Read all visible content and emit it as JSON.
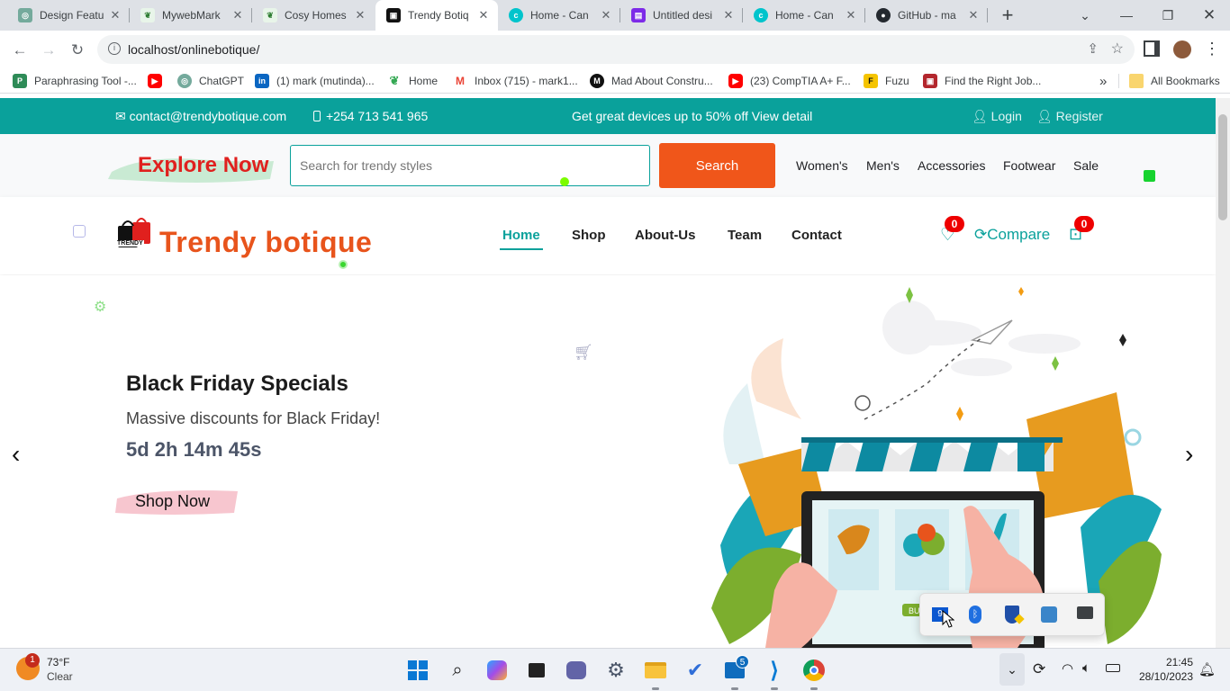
{
  "browser": {
    "tabs": [
      {
        "title": "Design Featu",
        "active": false
      },
      {
        "title": "MywebMark",
        "active": false
      },
      {
        "title": "Cosy Homes",
        "active": false
      },
      {
        "title": "Trendy Botiq",
        "active": true
      },
      {
        "title": "Home - Can",
        "active": false
      },
      {
        "title": "Untitled desi",
        "active": false
      },
      {
        "title": "Home - Can",
        "active": false
      },
      {
        "title": "GitHub - ma",
        "active": false
      }
    ],
    "new_tab_label": "+",
    "url": "localhost/onlinebotique/",
    "bookmarks": [
      {
        "label": "Paraphrasing Tool -...",
        "icon": "paraphrase-icon",
        "color": "#2e8b57"
      },
      {
        "label": "",
        "icon": "youtube-icon",
        "color": "#ff0000"
      },
      {
        "label": "ChatGPT",
        "icon": "chatgpt-icon",
        "color": "#74aa9c"
      },
      {
        "label": "(1) mark (mutinda)...",
        "icon": "linkedin-icon",
        "color": "#0a66c2"
      },
      {
        "label": "Home",
        "icon": "leaf-icon",
        "color": "#34a853"
      },
      {
        "label": "Inbox (715) - mark1...",
        "icon": "gmail-icon",
        "color": "#ea4335"
      },
      {
        "label": "Mad About Constru...",
        "icon": "mad-icon",
        "color": "#111111"
      },
      {
        "label": "(23) CompTIA A+ F...",
        "icon": "youtube-icon",
        "color": "#ff0000"
      },
      {
        "label": "Fuzu",
        "icon": "fuzu-icon",
        "color": "#222222"
      },
      {
        "label": "Find the Right Job...",
        "icon": "job-icon",
        "color": "#b3262d"
      }
    ],
    "bookmarks_overflow": "»",
    "all_bookmarks": "All Bookmarks"
  },
  "site": {
    "topbar": {
      "email": "contact@trendybotique.com",
      "phone": "+254 713 541 965",
      "promo": "Get great devices up to 50% off View detail",
      "login": "Login",
      "register": "Register",
      "bg_color": "#0aa19b"
    },
    "search": {
      "explore": "Explore Now",
      "placeholder": "Search for trendy styles",
      "button": "Search",
      "categories": [
        "Women's",
        "Men's",
        "Accessories",
        "Footwear",
        "Sale"
      ]
    },
    "nav": {
      "logo_small": "TRENDY",
      "brand": "Trendy botique",
      "links": [
        "Home",
        "Shop",
        "About-Us",
        "Team",
        "Contact"
      ],
      "active_link": "Home",
      "wishlist_count": "0",
      "compare": "Compare",
      "cart_count": "0",
      "brand_color": "#e8541c",
      "accent_color": "#0aa19b"
    },
    "hero": {
      "title": "Black Friday Specials",
      "subtitle": "Massive discounts for Black Friday!",
      "countdown": "5d 2h 14m 45s",
      "cta": "Shop Now",
      "illustration_tag": "BU"
    }
  },
  "tray_popup": {
    "icons": [
      "nvidia-icon",
      "bluetooth-icon",
      "defender-icon",
      "network-adapter-icon",
      "display-icon"
    ],
    "first_label": "9"
  },
  "taskbar": {
    "weather_temp": "73°F",
    "weather_desc": "Clear",
    "weather_badge": "1",
    "mail_badge": "5",
    "time": "21:45",
    "date": "28/10/2023"
  }
}
